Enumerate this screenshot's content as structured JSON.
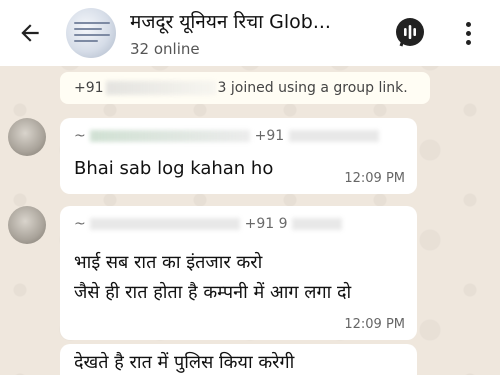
{
  "header": {
    "back_icon": "arrow-left-icon",
    "group_name": "मजदूर यूनियन रिचा Glob...",
    "online_status": "32 online",
    "call_icon": "voice-chat-icon",
    "menu_icon": "more-vert-icon"
  },
  "system_notice": {
    "prefix": "+91",
    "suffix": "3 joined using a group link."
  },
  "messages": [
    {
      "sender_prefix": "~",
      "sender_phone": "+91",
      "lines": [
        "Bhai sab log kahan ho"
      ],
      "time": "12:09 PM"
    },
    {
      "sender_prefix": "~",
      "sender_phone": "+91 9",
      "lines": [
        "भाई सब रात का इंतजार करो",
        "जैसे ही रात होता है कम्पनी में आग लगा दो"
      ],
      "time": "12:09 PM"
    },
    {
      "lines": [
        "देखते है रात में पुलिस किया करेगी"
      ]
    }
  ],
  "colors": {
    "chat_background": "#efe7dd",
    "bubble": "#ffffff",
    "header": "#ffffff"
  }
}
